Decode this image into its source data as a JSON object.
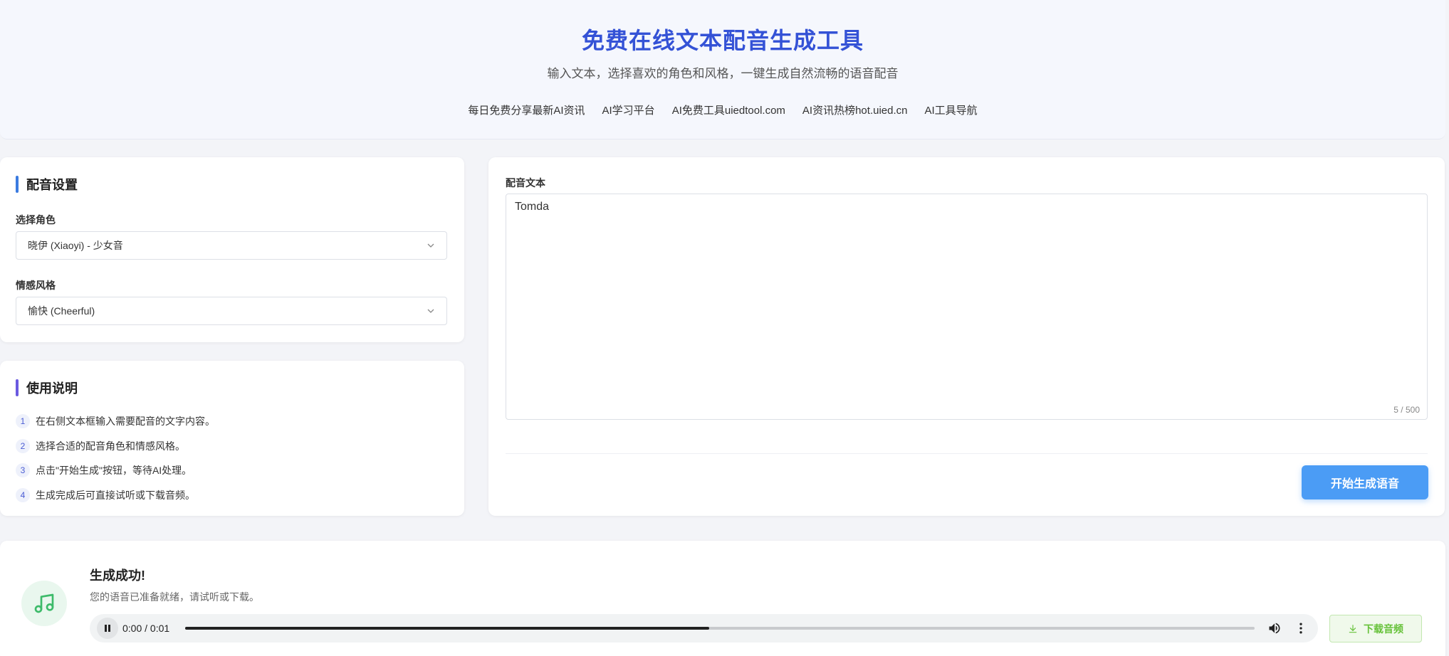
{
  "header": {
    "title": "免费在线文本配音生成工具",
    "subtitle": "输入文本，选择喜欢的角色和风格，一键生成自然流畅的语音配音",
    "nav": [
      "每日免费分享最新AI资讯",
      "AI学习平台",
      "AI免费工具uiedtool.com",
      "AI资讯热榜hot.uied.cn",
      "AI工具导航"
    ]
  },
  "settings": {
    "title": "配音设置",
    "accent": "#3b7be0",
    "role_label": "选择角色",
    "role_value": "晓伊 (Xiaoyi) - 少女音",
    "style_label": "情感风格",
    "style_value": "愉快 (Cheerful)"
  },
  "instructions": {
    "title": "使用说明",
    "accent": "#6a5ae0",
    "steps": [
      {
        "num": "1",
        "text": "在右侧文本框输入需要配音的文字内容。"
      },
      {
        "num": "2",
        "text": "选择合适的配音角色和情感风格。"
      },
      {
        "num": "3",
        "text": "点击\"开始生成\"按钮，等待AI处理。"
      },
      {
        "num": "4",
        "text": "生成完成后可直接试听或下载音频。"
      }
    ]
  },
  "editor": {
    "label": "配音文本",
    "text": "Tomda",
    "count": "5 / 500",
    "generate_label": "开始生成语音"
  },
  "result": {
    "title": "生成成功!",
    "desc": "您的语音已准备就绪，请试听或下载。",
    "time": "0:00 / 0:01",
    "progress": 0.49,
    "download_label": "下载音频",
    "icon": "music-note-icon",
    "success_color": "#3dbb6a"
  }
}
